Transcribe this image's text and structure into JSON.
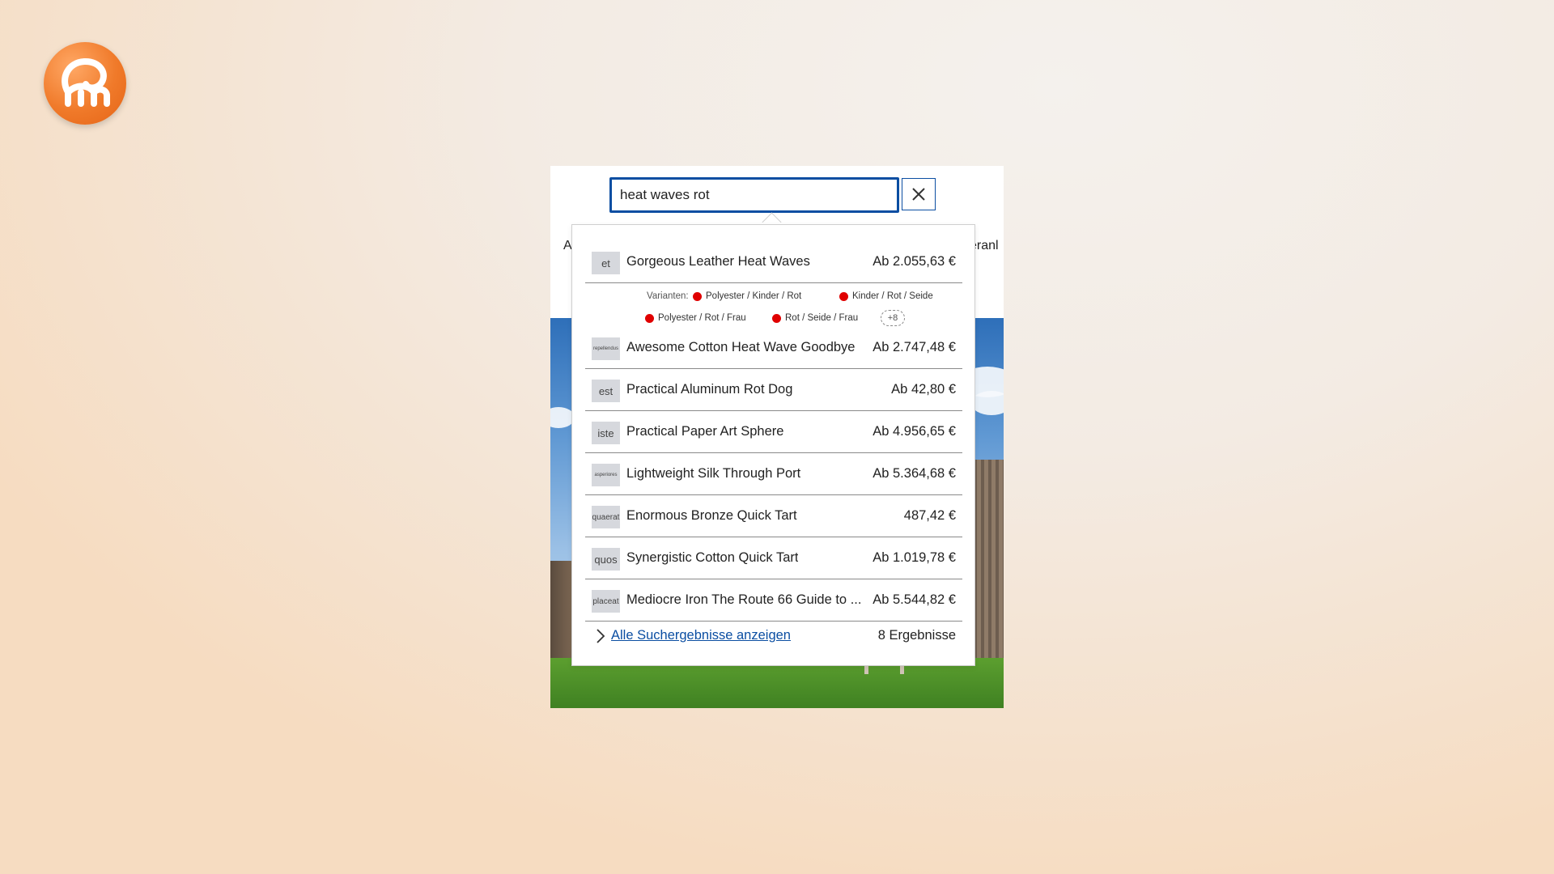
{
  "search": {
    "value": "heat waves rot",
    "clear_icon": "close-icon"
  },
  "logo": {
    "icon": "brand-logo"
  },
  "nav": {
    "left_partial": "A",
    "right_partial": "eranl"
  },
  "results": [
    {
      "thumb": "et",
      "name": "Gorgeous Leather Heat Waves",
      "price": "Ab 2.055,63 €"
    },
    {
      "thumb": "repellendus",
      "name": "Awesome Cotton Heat Wave Goodbye",
      "price": "Ab 2.747,48 €"
    },
    {
      "thumb": "est",
      "name": "Practical Aluminum Rot Dog",
      "price": "Ab 42,80 €"
    },
    {
      "thumb": "iste",
      "name": "Practical Paper Art Sphere",
      "price": "Ab 4.956,65 €"
    },
    {
      "thumb": "asperiores",
      "name": "Lightweight Silk Through Port",
      "price": "Ab 5.364,68 €"
    },
    {
      "thumb": "quaerat",
      "name": "Enormous Bronze Quick Tart",
      "price": "487,42 €"
    },
    {
      "thumb": "quos",
      "name": "Synergistic Cotton Quick Tart",
      "price": "Ab 1.019,78 €"
    },
    {
      "thumb": "placeat",
      "name": "Mediocre Iron The Route 66 Guide to ...",
      "price": "Ab 5.544,82 €"
    }
  ],
  "variants": {
    "label": "Varianten:",
    "items": [
      "Polyester / Kinder / Rot",
      "Kinder / Rot / Seide",
      "Polyester / Rot / Frau",
      "Rot / Seide / Frau"
    ],
    "more": "+8",
    "dot_color": "#e00000"
  },
  "footer": {
    "all_results": "Alle Suchergebnisse anzeigen",
    "count": "8 Ergebnisse"
  },
  "colors": {
    "accent": "#0b4ea2",
    "brand": "#f07a2a"
  }
}
